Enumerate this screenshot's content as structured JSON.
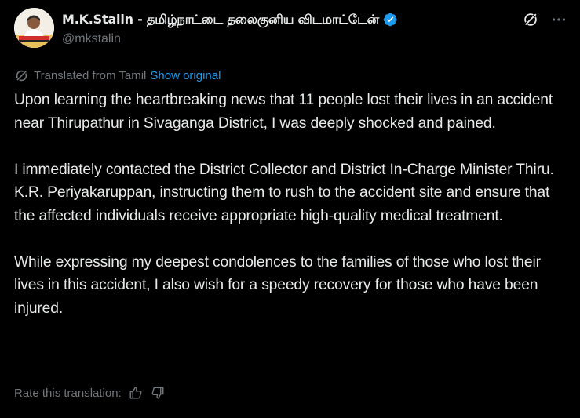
{
  "author": {
    "display_name": "M.K.Stalin - தமிழ்நாட்டை தலைகுனிய விடமாட்டேன்",
    "handle": "@mkstalin",
    "verified": true,
    "verified_color": "#1d9bf0"
  },
  "icons": {
    "avatar": "avatar",
    "verified": "verified-badge-icon",
    "grok": "grok-icon",
    "more": "more-options-icon",
    "translate": "translate-icon",
    "thumbs_up": "thumbs-up-icon",
    "thumbs_down": "thumbs-down-icon"
  },
  "translation": {
    "label": "Translated from Tamil",
    "show_original": "Show original",
    "rate_label": "Rate this translation:"
  },
  "post": {
    "paragraphs": [
      "Upon learning the heartbreaking news that 11 people lost their lives in an accident near Thirupathur in Sivaganga District, I was deeply shocked and pained.",
      "I immediately contacted the District Collector and District In-Charge Minister Thiru. K.R. Periyakaruppan, instructing them to rush to the accident site and ensure that the affected individuals receive appropriate high-quality medical treatment.",
      "While expressing my deepest condolences to the families of those who lost their lives in this accident, I also wish for a speedy recovery for those who have been injured."
    ]
  },
  "colors": {
    "background": "#000000",
    "text_primary": "#e7e9ea",
    "text_secondary": "#71767b",
    "link": "#1d9bf0"
  }
}
